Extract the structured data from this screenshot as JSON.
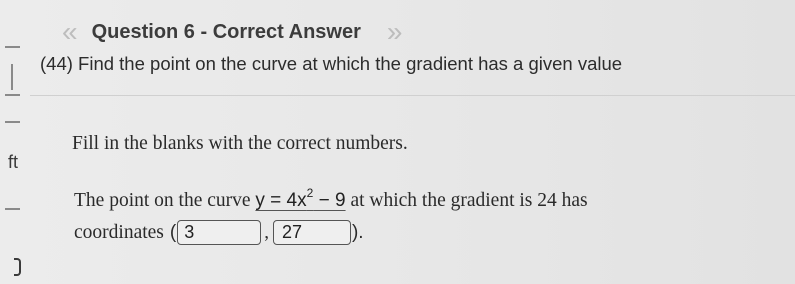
{
  "header": {
    "prev_arrow": "«",
    "title": "Question 6 - Correct Answer",
    "next_arrow": "»"
  },
  "subtitle": "(44) Find the point on the curve at which the gradient has a given value",
  "left_edge": {
    "text": "ft"
  },
  "instruction": "Fill in the blanks with the correct numbers.",
  "problem": {
    "text_before": "The point on the curve",
    "equation_lhs": "y = 4x",
    "equation_exponent": "2",
    "equation_rhs": " − 9",
    "text_after": "at which the gradient is 24 has",
    "coordinates_label": "coordinates",
    "open_paren": "(",
    "comma": ",",
    "close_paren": ").",
    "answer_x": "3",
    "answer_y": "27"
  }
}
